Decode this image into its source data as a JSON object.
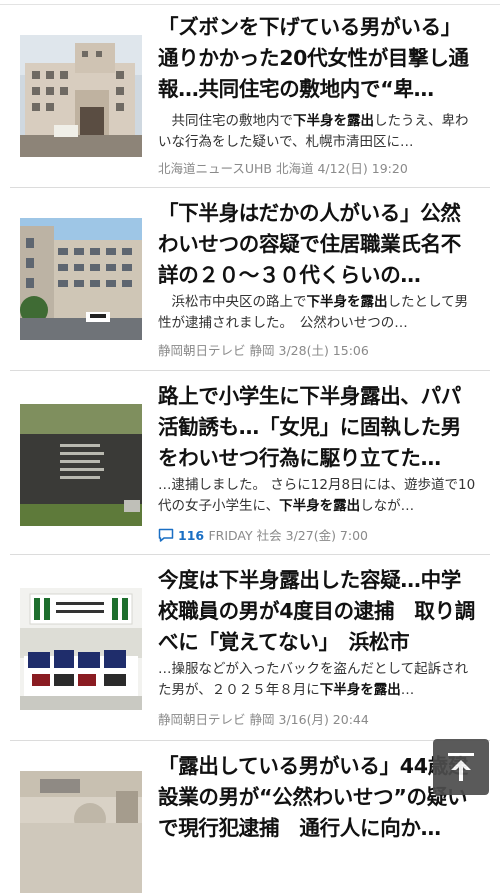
{
  "articles": [
    {
      "title": "「ズボンを下げている男がいる」通りかかった20代女性が目撃し通報…共同住宅の敷地内で“卑…",
      "snippet_pre": "　共同住宅の敷地内で",
      "snippet_bold": "下半身を露出",
      "snippet_post": "したうえ、卑わいな行為をした疑いで、札幌市清田区に…",
      "source": "北海道ニュースUHB",
      "category": "北海道",
      "date": "4/12(日) 19:20",
      "comments": ""
    },
    {
      "title": "「下半身はだかの人がいる」公然わいせつの容疑で住居職業氏名不詳の２０～３０代くらいの…",
      "snippet_pre": "　浜松市中央区の路上で",
      "snippet_bold": "下半身を露出",
      "snippet_post": "したとして男性が逮捕されました。　公然わいせつの…",
      "source": "静岡朝日テレビ",
      "category": "静岡",
      "date": "3/28(土) 15:06",
      "comments": ""
    },
    {
      "title": "路上で小学生に下半身露出、パパ活勧誘も…「女児」に固執した男をわいせつ行為に駆り立てた…",
      "snippet_pre": "…逮捕しました。 さらに12月8日には、遊歩道で10代の女子小学生に、",
      "snippet_bold": "下半身を露出",
      "snippet_post": "しなが…",
      "source": "FRIDAY",
      "category": "社会",
      "date": "3/27(金) 7:00",
      "comments": "116"
    },
    {
      "title": "今度は下半身露出した容疑…中学校職員の男が4度目の逮捕　取り調べに「覚えてない」　浜松市",
      "snippet_pre": "…操服などが入ったバックを盗んだとして起訴された男が、２０２５年８月に",
      "snippet_bold": "下半身を露出",
      "snippet_post": "…",
      "source": "静岡朝日テレビ",
      "category": "静岡",
      "date": "3/16(月) 20:44",
      "comments": ""
    },
    {
      "title": "「露出している男がいる」44歳建設業の男が“公然わいせつ”の疑いで現行犯逮捕　通行人に向か…",
      "snippet_pre": "",
      "snippet_bold": "",
      "snippet_post": "",
      "source": "",
      "category": "",
      "date": "",
      "comments": ""
    }
  ],
  "thumbnails": [
    "hospital-building",
    "office-building",
    "court-sign",
    "evidence-display",
    "police-station"
  ],
  "colors": {
    "link_blue": "#1a6fc4",
    "meta_gray": "#8a8a8a",
    "back_to_top": "#4d4d4d"
  },
  "back_to_top_icon": "arrow-up-to-line-icon"
}
